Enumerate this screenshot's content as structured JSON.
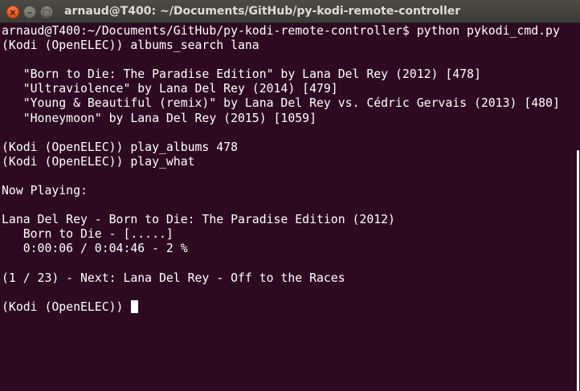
{
  "window": {
    "title": "arnaud@T400: ~/Documents/GitHub/py-kodi-remote-controller",
    "close_glyph": "×",
    "minimize_glyph": "–",
    "maximize_glyph": "□"
  },
  "terminal": {
    "background": "#2d0a22",
    "foreground": "#ffffff",
    "lines": [
      "arnaud@T400:~/Documents/GitHub/py-kodi-remote-controller$ python pykodi_cmd.py",
      "(Kodi (OpenELEC)) albums_search lana",
      "",
      "   \"Born to Die: The Paradise Edition\" by Lana Del Rey (2012) [478]",
      "   \"Ultraviolence\" by Lana Del Rey (2014) [479]",
      "   \"Young & Beautiful (remix)\" by Lana Del Rey vs. Cédric Gervais (2013) [480]",
      "   \"Honeymoon\" by Lana Del Rey (2015) [1059]",
      "",
      "(Kodi (OpenELEC)) play_albums 478",
      "(Kodi (OpenELEC)) play_what",
      "",
      "Now Playing:",
      "",
      "Lana Del Rey - Born to Die: The Paradise Edition (2012)",
      "   Born to Die - [.....]",
      "   0:00:06 / 0:04:46 - 2 %",
      "",
      "(1 / 23) - Next: Lana Del Rey - Off to the Races",
      ""
    ],
    "prompt": "(Kodi (OpenELEC)) "
  }
}
